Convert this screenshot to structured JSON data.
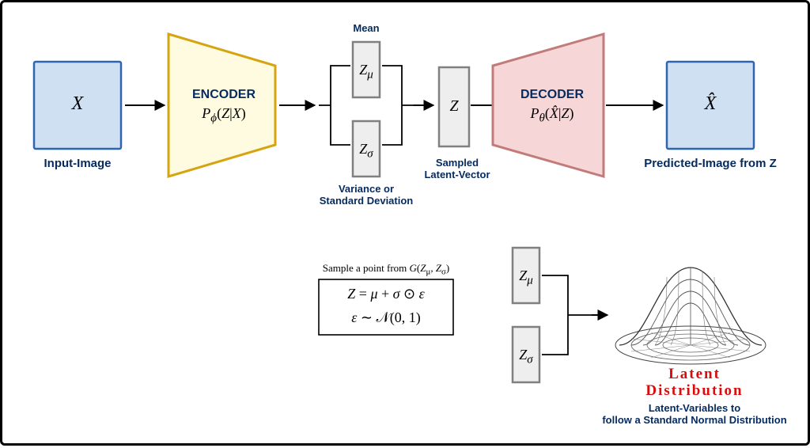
{
  "colors": {
    "blueFill": "#cfe0f3",
    "blueStroke": "#2f64b0",
    "encoderFill": "#fffbe1",
    "encoderStroke": "#d6a411",
    "decoderFill": "#f6d6d6",
    "decoderStroke": "#c27a7a",
    "grayFill": "#eeeeee",
    "grayStroke": "#808080",
    "navy": "#052a5e",
    "red": "#d90d0d"
  },
  "top": {
    "input": {
      "symbol": "X",
      "caption": "Input-Image"
    },
    "encoder": {
      "title": "ENCODER",
      "formula": "P_ϕ(Z|X)"
    },
    "zmu": {
      "symbol": "Z_μ",
      "caption": "Mean"
    },
    "zsigma": {
      "symbol": "Z_σ",
      "caption": "Variance or\nStandard Deviation"
    },
    "z": {
      "symbol": "Z",
      "caption": "Sampled\nLatent-Vector"
    },
    "decoder": {
      "title": "DECODER",
      "formula": "P_θ(X̂|Z)"
    },
    "output": {
      "symbol": "X̂",
      "caption": "Predicted-Image from Z"
    }
  },
  "bottom": {
    "sample_text": "Sample a point from G(Z_μ, Z_σ)",
    "eq1": "Z = μ + σ ⊙ ε",
    "eq2": "ε ∼ 𝒩(0, 1)",
    "zmu": "Z_μ",
    "zsigma": "Z_σ",
    "dist_title": "Latent\nDistribution",
    "dist_caption": "Latent-Variables to\nfollow a Standard Normal Distribution"
  }
}
